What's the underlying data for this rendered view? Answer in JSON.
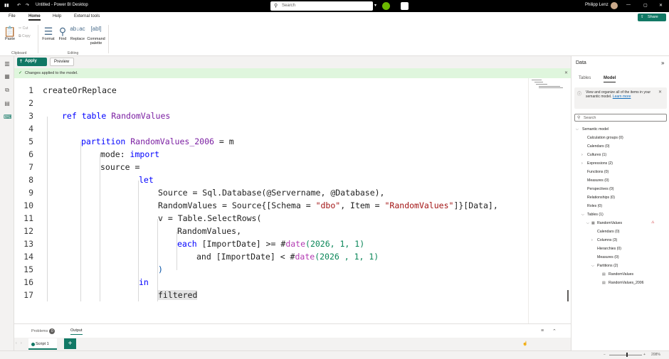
{
  "titlebar": {
    "doc_title": "Untitled - Power BI Desktop",
    "search_placeholder": "Search",
    "user_name": "Philipp Lenz"
  },
  "menu_tabs": [
    "File",
    "Home",
    "Help",
    "External tools"
  ],
  "share_label": "Share",
  "ribbon": {
    "paste": "Paste",
    "cut": "Cut",
    "copy": "Copy",
    "clipboard_group": "Clipboard",
    "format": "Format",
    "find": "Find",
    "replace": "Replace",
    "command_palette": "Command palette",
    "editing_group": "Editing"
  },
  "toolbar": {
    "apply": "Apply",
    "preview": "Preview"
  },
  "notice": "Changes applied to the model.",
  "code_lines": [
    "1",
    "2",
    "3",
    "4",
    "5",
    "6",
    "7",
    "8",
    "9",
    "10",
    "11",
    "12",
    "13",
    "14",
    "15",
    "16",
    "17"
  ],
  "code": {
    "l1": "createOrReplace",
    "l3a": "ref table ",
    "l3b": "RandomValues",
    "l5a": "partition ",
    "l5b": "RandomValues_2006",
    "l5c": " = m",
    "l6a": "mode: ",
    "l6b": "import",
    "l7": "source =",
    "l8": "let",
    "l9": "Source = Sql.Database(@Servername, @Database),",
    "l10a": "RandomValues = Source{[Schema = ",
    "l10b": "\"dbo\"",
    "l10c": ", Item = ",
    "l10d": "\"RandomValues\"",
    "l10e": "]}[Data],",
    "l11": "v = Table.SelectRows(",
    "l12": "RandomValues,",
    "l13a": "each",
    "l13b": " [ImportDate] >= #",
    "l13c": "date",
    "l13d": "(2026, 1, 1)",
    "l14a": "and [ImportDate] < #",
    "l14b": "date",
    "l14c": "(2026 , 1, 1)",
    "l15": ")",
    "l16": "in",
    "l17": "filtered"
  },
  "bottom_tabs": {
    "problems": "Problems",
    "problems_count": "0",
    "output": "Output"
  },
  "script_tab": "Script 1",
  "zoom": "208%",
  "data_pane": {
    "title": "Data",
    "tab_tables": "Tables",
    "tab_model": "Model",
    "info_text": "View and organize all of the items in your semantic model.",
    "info_link": "Learn more",
    "search_placeholder": "Search",
    "tree": {
      "root": "Semantic model",
      "calc_groups": "Calculation groups (0)",
      "calendars": "Calendars (0)",
      "cultures": "Cultures (1)",
      "expressions": "Expressions (2)",
      "functions": "Functions (0)",
      "measures": "Measures (0)",
      "perspectives": "Perspectives (0)",
      "relationships": "Relationships (0)",
      "roles": "Roles (0)",
      "tables": "Tables (1)",
      "table_name": "RandomValues",
      "t_calendars": "Calendars (0)",
      "t_columns": "Columns (3)",
      "t_hierarchies": "Hierarchies (0)",
      "t_measures": "Measures (0)",
      "t_partitions": "Partitions (2)",
      "part1": "RandomValues",
      "part2": "RandomValues_2006"
    }
  },
  "colors": {
    "accent": "#117865",
    "keyword": "#0000ff",
    "name": "#7b1fa2",
    "string": "#a31515"
  }
}
